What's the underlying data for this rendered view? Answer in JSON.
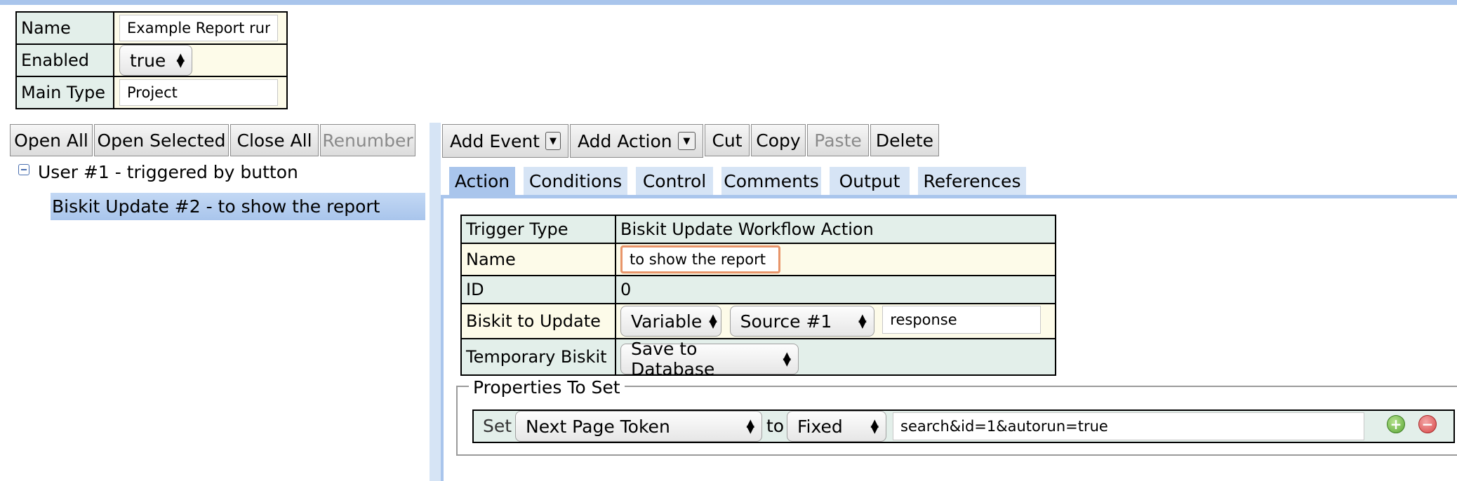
{
  "header": {
    "name_label": "Name",
    "name_value": "Example Report run fi",
    "enabled_label": "Enabled",
    "enabled_value": "true",
    "main_type_label": "Main Type",
    "main_type_value": "Project"
  },
  "tree_toolbar": {
    "open_all": "Open All",
    "open_selected": "Open Selected",
    "close_all": "Close All",
    "renumber": "Renumber"
  },
  "tree": {
    "root": "User #1 - triggered by button",
    "child": "Biskit Update #2 - to show the report"
  },
  "action_toolbar": {
    "add_event": "Add Event",
    "add_action": "Add Action",
    "cut": "Cut",
    "copy": "Copy",
    "paste": "Paste",
    "delete": "Delete"
  },
  "tabs": [
    "Action",
    "Conditions",
    "Control",
    "Comments",
    "Output",
    "References"
  ],
  "action_form": {
    "trigger_type_label": "Trigger Type",
    "trigger_type_value": "Biskit Update Workflow Action",
    "name_label": "Name",
    "name_value": "to show the report",
    "id_label": "ID",
    "id_value": "0",
    "biskit_label": "Biskit to Update",
    "biskit_kind": "Variable",
    "biskit_source": "Source #1",
    "biskit_var": "response",
    "temp_label": "Temporary Biskit",
    "temp_value": "Save to Database"
  },
  "properties": {
    "legend": "Properties To Set",
    "set_label": "Set",
    "property": "Next Page Token",
    "to_label": "to",
    "mode": "Fixed",
    "value": "search&id=1&autorun=true"
  },
  "colors": {
    "accent": "#a9c5ec",
    "tab_bg": "#d6e4f5",
    "label_bg": "#e3efea",
    "value_bg": "#fdfbe9",
    "focus_border": "#e8956a"
  }
}
